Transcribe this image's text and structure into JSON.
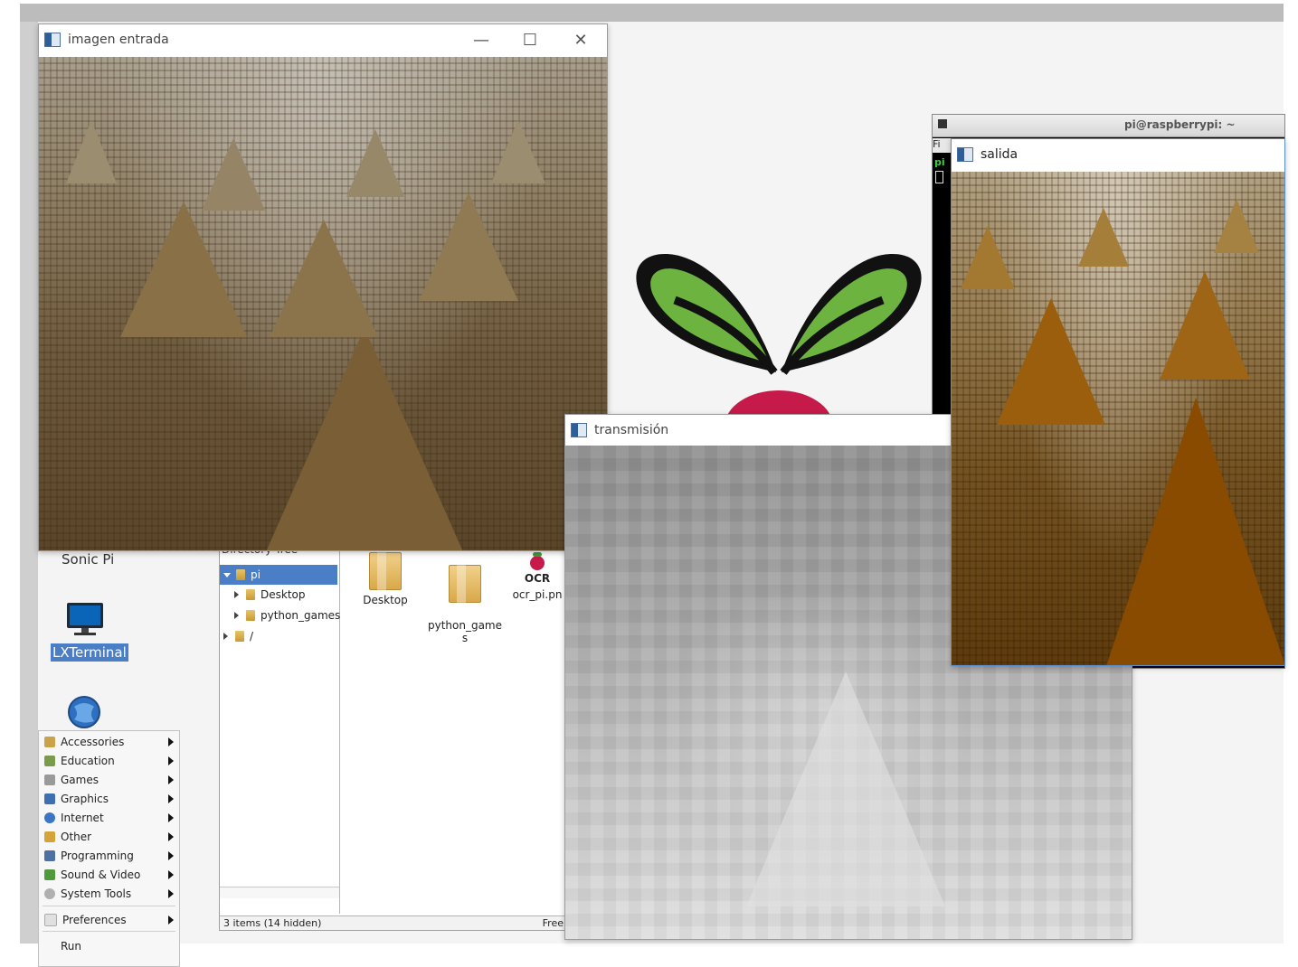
{
  "windows": {
    "entrada": {
      "title": "imagen entrada"
    },
    "salida": {
      "title": "salida"
    },
    "transmision": {
      "title": "transmisión"
    },
    "terminal": {
      "title": "pi@raspberrypi: ~",
      "menu_fragment": "Fi",
      "prompt_fragment": "pi"
    }
  },
  "window_controls": {
    "minimize": "—",
    "maximize": "☐",
    "close": "✕"
  },
  "desktop": {
    "icons": [
      {
        "label": "Sonic Pi"
      },
      {
        "label": "LXTerminal"
      }
    ]
  },
  "file_manager": {
    "dir_tree_title": "Directory Tree",
    "tree": [
      {
        "label": "pi",
        "selected": true
      },
      {
        "label": "Desktop"
      },
      {
        "label": "python_games"
      },
      {
        "label": "/"
      }
    ],
    "files": [
      {
        "label": "Desktop"
      },
      {
        "label": "python_game\ns"
      },
      {
        "label": "ocr_pi.pn",
        "badge": "OCR"
      }
    ],
    "status_left": "3 items (14 hidden)",
    "status_right": "Free"
  },
  "menu": {
    "items": [
      {
        "label": "Accessories",
        "icon_color": "#c9a24a"
      },
      {
        "label": "Education",
        "icon_color": "#7a9b4c"
      },
      {
        "label": "Games",
        "icon_color": "#9a9a9a"
      },
      {
        "label": "Graphics",
        "icon_color": "#3f6fb0"
      },
      {
        "label": "Internet",
        "icon_color": "#3a76c4"
      },
      {
        "label": "Other",
        "icon_color": "#d4a43a"
      },
      {
        "label": "Programming",
        "icon_color": "#4d6fa3"
      },
      {
        "label": "Sound & Video",
        "icon_color": "#4f9a3c"
      },
      {
        "label": "System Tools",
        "icon_color": "#b0b0b0"
      }
    ],
    "preferences": "Preferences",
    "run": "Run"
  },
  "colors": {
    "selection": "#4a7ec7",
    "desktop_bg": "#f4f4f4",
    "raspberry_leaf": "#6db33f",
    "raspberry_berry": "#c51a4a"
  }
}
